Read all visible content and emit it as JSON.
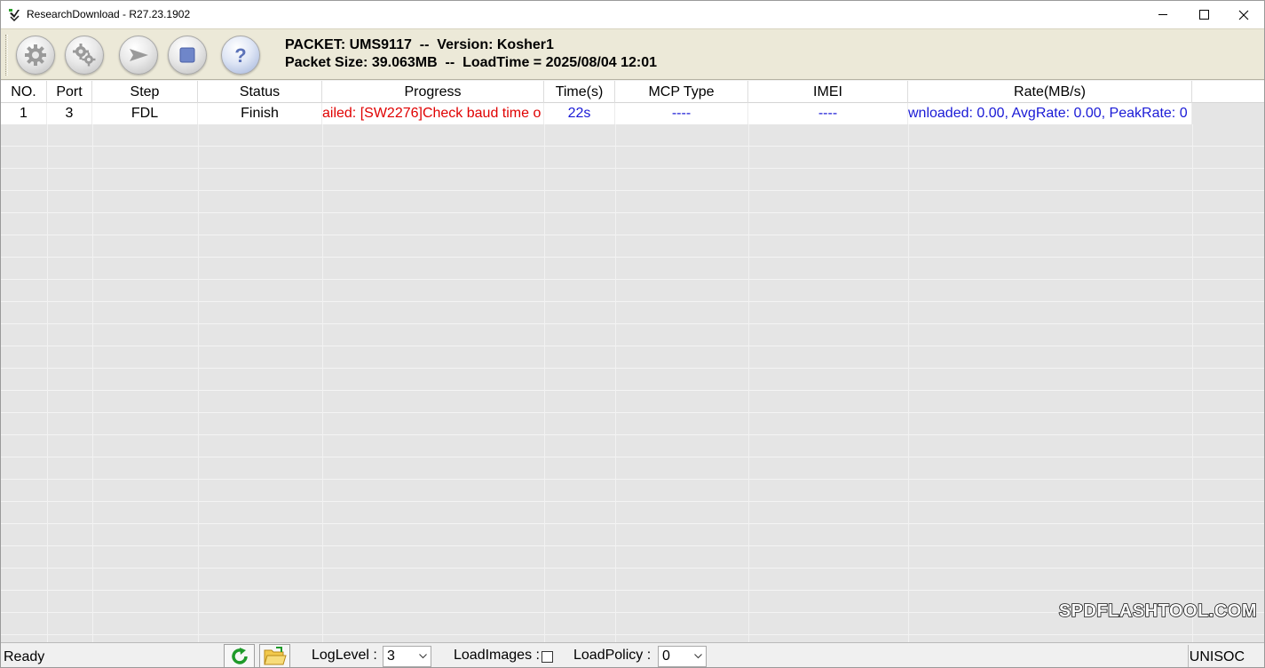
{
  "window": {
    "title": "ResearchDownload - R27.23.1902"
  },
  "toolbar": {
    "buttons": [
      {
        "name": "settings-button",
        "icon": "gear-icon"
      },
      {
        "name": "advanced-settings-button",
        "icon": "gears-icon"
      },
      {
        "name": "start-download-button",
        "icon": "play-arrow-icon"
      },
      {
        "name": "stop-download-button",
        "icon": "stop-square-icon"
      },
      {
        "name": "help-button",
        "icon": "question-mark-icon"
      }
    ],
    "packet_line1": "PACKET: UMS9117  --  Version: Kosher1",
    "packet_line2": "Packet Size: 39.063MB  --  LoadTime = 2025/08/04 12:01"
  },
  "table": {
    "headers": {
      "no": "NO.",
      "port": "Port",
      "step": "Step",
      "status": "Status",
      "progress": "Progress",
      "time": "Time(s)",
      "mcp": "MCP Type",
      "imei": "IMEI",
      "rate": "Rate(MB/s)"
    },
    "rows": [
      {
        "no": "1",
        "port": "3",
        "step": "FDL",
        "status": "Finish",
        "progress": "ailed: [SW2276]Check baud time o",
        "time": "22s",
        "mcp": "----",
        "imei": "----",
        "rate": "wnloaded: 0.00, AvgRate: 0.00, PeakRate: 0"
      }
    ]
  },
  "watermark": "SPDFLASHTOOL.COM",
  "statusbar": {
    "ready": "Ready",
    "loglevel_label": "LogLevel :",
    "loglevel_value": "3",
    "loadimages_label": "LoadImages :",
    "loadimages_checked": false,
    "loadpolicy_label": "LoadPolicy :",
    "loadpolicy_value": "0",
    "brand": "UNISOC"
  },
  "colors": {
    "toolbar_bg": "#ece9d8",
    "error_text": "#e00000",
    "info_text": "#1a1ad6",
    "grid_bg": "#e5e5e5"
  }
}
